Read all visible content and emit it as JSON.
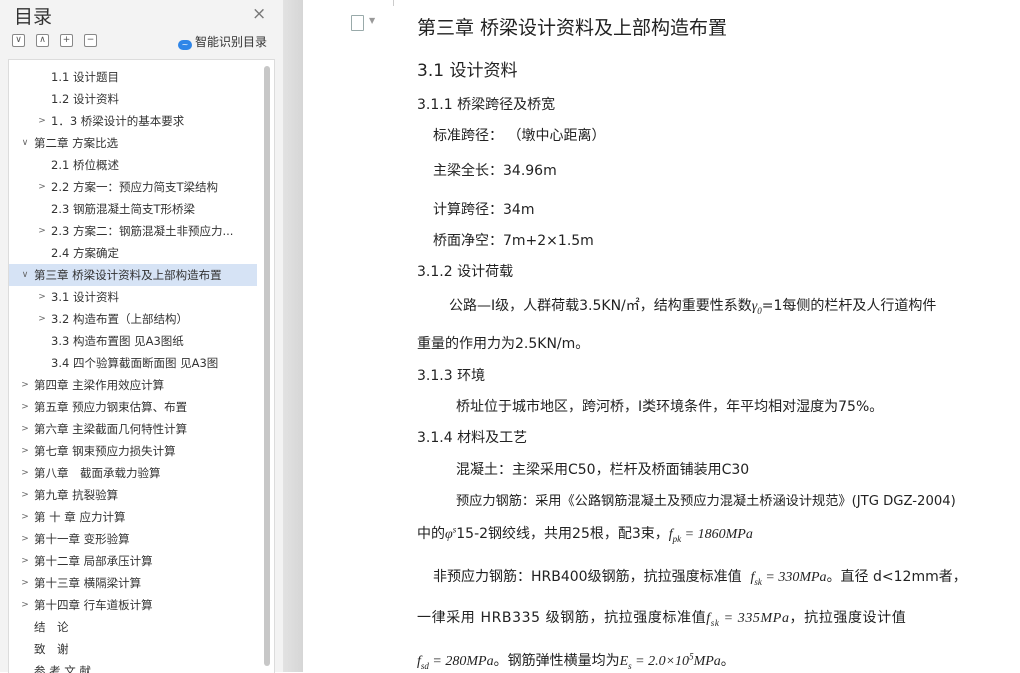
{
  "toc": {
    "title": "目录",
    "close": "×",
    "toolbar": [
      "∨",
      "∧",
      "+",
      "−"
    ],
    "smart_label": "智能识别目录",
    "items": [
      {
        "label": "1.1 设计题目",
        "arrow": ""
      },
      {
        "label": "1.2 设计资料",
        "arrow": ""
      },
      {
        "label": "1．3 桥梁设计的基本要求",
        "arrow": ">"
      },
      {
        "label": "第二章 方案比选",
        "arrow": "∨"
      },
      {
        "label": "2.1 桥位概述",
        "arrow": ""
      },
      {
        "label": "2.2 方案一：预应力简支T梁结构",
        "arrow": ">"
      },
      {
        "label": "2.3 钢筋混凝土简支T形桥梁",
        "arrow": ""
      },
      {
        "label": "2.3 方案二：钢筋混凝土非预应力...",
        "arrow": ">"
      },
      {
        "label": "2.4 方案确定",
        "arrow": ""
      },
      {
        "label": "第三章 桥梁设计资料及上部构造布置",
        "arrow": "∨",
        "selected": true
      },
      {
        "label": "3.1 设计资料",
        "arrow": ">"
      },
      {
        "label": "3.2 构造布置（上部结构）",
        "arrow": ">"
      },
      {
        "label": "3.3 构造布置图 见A3图纸",
        "arrow": ""
      },
      {
        "label": "3.4 四个验算截面断面图 见A3图",
        "arrow": ""
      },
      {
        "label": "第四章 主梁作用效应计算",
        "arrow": ">"
      },
      {
        "label": "第五章 预应力钢束估算、布置",
        "arrow": ">"
      },
      {
        "label": "第六章 主梁截面几何特性计算",
        "arrow": ">"
      },
      {
        "label": "第七章 钢束预应力损失计算",
        "arrow": ">"
      },
      {
        "label": "第八章　截面承载力验算",
        "arrow": ">"
      },
      {
        "label": "第九章 抗裂验算",
        "arrow": ">"
      },
      {
        "label": "第 十 章 应力计算",
        "arrow": ">"
      },
      {
        "label": "第十一章 变形验算",
        "arrow": ">"
      },
      {
        "label": "第十二章 局部承压计算",
        "arrow": ">"
      },
      {
        "label": "第十三章 横隔梁计算",
        "arrow": ">"
      },
      {
        "label": "第十四章 行车道板计算",
        "arrow": ">"
      },
      {
        "label": "结　论",
        "arrow": ""
      },
      {
        "label": "致　谢",
        "arrow": ""
      },
      {
        "label": "参 考 文 献",
        "arrow": ""
      }
    ]
  },
  "doc": {
    "chapter_title": "第三章 桥梁设计资料及上部构造布置",
    "section_title": "3.1 设计资料",
    "s311": "3.1.1 桥梁跨径及桥宽",
    "span_std": "标准跨径：  （墩中心距离）",
    "beam_len": "主梁全长：34.96m",
    "calc_span": "计算跨径：34m",
    "deck_width": "桥面净空：7m+2×1.5m",
    "s312": "3.1.2 设计荷载",
    "load_p1a": "公路—Ⅰ级，人群荷载3.5KN/㎡，结构重要性系数",
    "load_gamma": "γ",
    "load_gamma_sub": "0",
    "load_p1b": "=1每侧的栏杆及人行道构件",
    "load_p2": "重量的作用力为2.5KN/m。",
    "s313": "3.1.3 环境",
    "env_p": "桥址位于城市地区，跨河桥，Ⅰ类环境条件，年平均相对湿度为75%。",
    "s314": "3.1.4 材料及工艺",
    "mat_p1": "混凝土：主梁采用C50，栏杆及桥面铺装用C30",
    "mat_p2": "预应力钢筋：采用《公路钢筋混凝土及预应力混凝土桥涵设计规范》(JTG DGZ-2004)",
    "mat_p3a": "中的",
    "mat_phi": "φ",
    "mat_phi_sup": "s",
    "mat_p3b": "15-2钢绞线，共用25根，配3束，",
    "mat_fpk": "f",
    "mat_fpk_sub": "pk",
    "mat_fpk_val": " = 1860MPa",
    "mat_p4a": "非预应力钢筋：HRB400级钢筋，抗拉强度标准值",
    "mat_fsk1": "f",
    "mat_fsk1_sub": "sk",
    "mat_fsk1_val": " = 330MPa",
    "mat_p4b": "。直径 d<12mm者，",
    "mat_p5a": "一律采用 HRB335 级钢筋，抗拉强度标准值",
    "mat_fsk2": "f",
    "mat_fsk2_sub": "sk",
    "mat_fsk2_val": " = 335MPa",
    "mat_p5b": "，抗拉强度设计值",
    "mat_fsd": "f",
    "mat_fsd_sub": "sd",
    "mat_fsd_val": " = 280MPa",
    "mat_p6": "。钢筋弹性横量均为",
    "mat_es": "E",
    "mat_es_sub": "s",
    "mat_es_val": " = 2.0×10",
    "mat_es_sup": "5",
    "mat_es_unit": "MPa",
    "mat_p6end": "。"
  }
}
